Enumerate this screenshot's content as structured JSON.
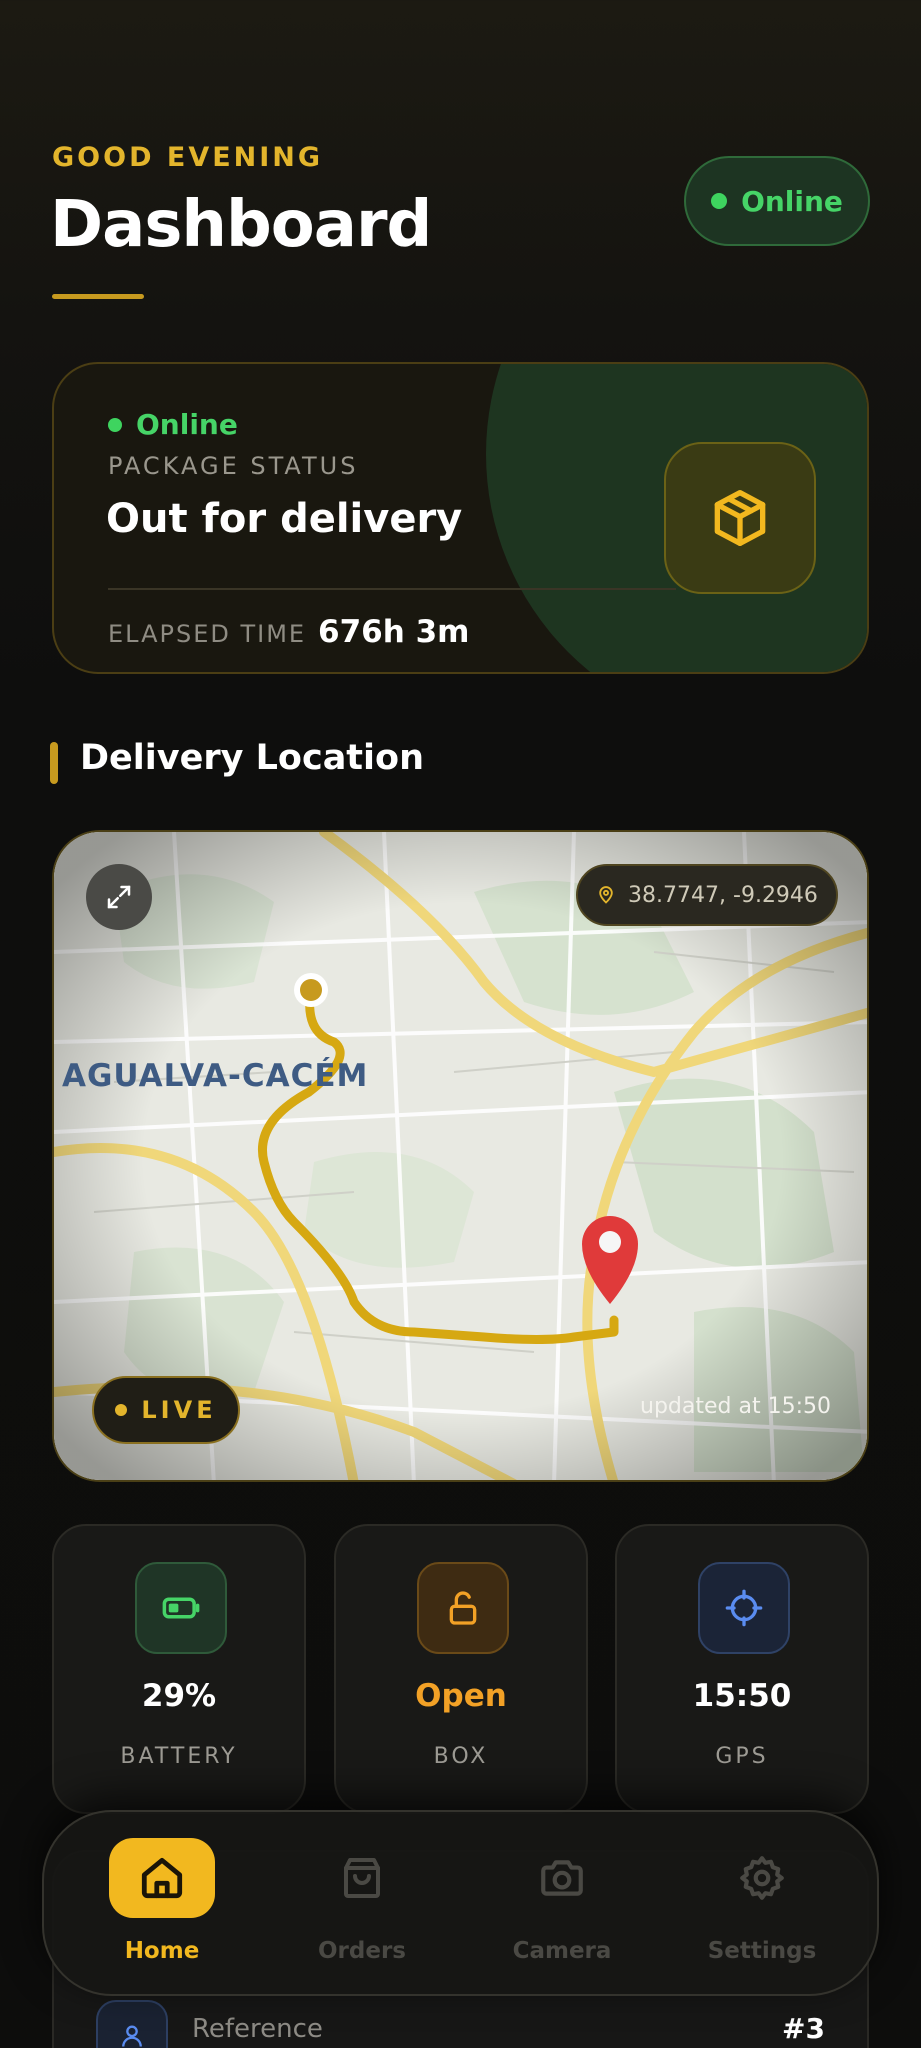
{
  "header": {
    "greeting": "GOOD EVENING",
    "title": "Dashboard",
    "status": "Online"
  },
  "package": {
    "online_label": "Online",
    "status_label": "PACKAGE STATUS",
    "status_value": "Out for delivery",
    "elapsed_label": "ELAPSED TIME",
    "elapsed_value": "676h 3m",
    "icon": "package-icon"
  },
  "location_section": {
    "title": "Delivery Location"
  },
  "map": {
    "coordinates": "38.7747, -9.2946",
    "city_label": "AGUALVA-CACÉM",
    "live_label": "LIVE",
    "updated_text": "updated at 15:50",
    "expand_icon": "expand-icon",
    "pin_icon": "location-pin-icon"
  },
  "stats": [
    {
      "value": "29%",
      "label": "BATTERY",
      "icon": "battery-icon",
      "color": "#ffffff"
    },
    {
      "value": "Open",
      "label": "BOX",
      "icon": "unlock-icon",
      "color": "#f2a126"
    },
    {
      "value": "15:50",
      "label": "GPS",
      "icon": "crosshair-icon",
      "color": "#ffffff"
    }
  ],
  "reference": {
    "label": "Reference",
    "value": "#3"
  },
  "nav": {
    "items": [
      {
        "label": "Home",
        "icon": "home-icon",
        "active": true
      },
      {
        "label": "Orders",
        "icon": "shopping-bag-icon",
        "active": false
      },
      {
        "label": "Camera",
        "icon": "camera-icon",
        "active": false
      },
      {
        "label": "Settings",
        "icon": "gear-icon",
        "active": false
      }
    ]
  },
  "colors": {
    "accent": "#e3b52c",
    "online_green": "#46d467",
    "open_orange": "#f2a126",
    "route": "#d6a812",
    "pin_red": "#e03a3a"
  }
}
